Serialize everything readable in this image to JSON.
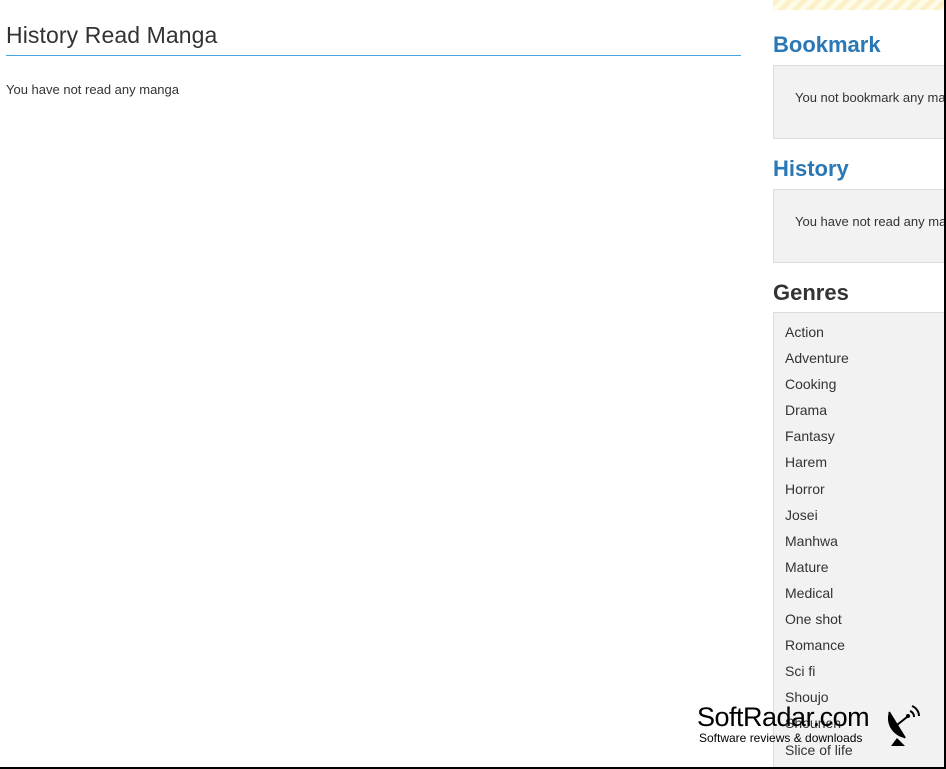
{
  "main": {
    "title": "History Read Manga",
    "empty_message": "You have not read any manga"
  },
  "sidebar": {
    "bookmark": {
      "title": "Bookmark",
      "message": "You not bookmark any ma"
    },
    "history": {
      "title": "History",
      "message": "You have not read any mar"
    },
    "genres": {
      "title": "Genres",
      "items": [
        "Action",
        "Adventure",
        "Cooking",
        "Drama",
        "Fantasy",
        "Harem",
        "Horror",
        "Josei",
        "Manhwa",
        "Mature",
        "Medical",
        "One shot",
        "Romance",
        "Sci fi",
        "Shoujo",
        "Shounen",
        "Slice of life"
      ]
    }
  },
  "watermark": {
    "name": "SoftRadar.com",
    "tagline": "Software reviews & downloads",
    "icon": "satellite-dish-icon"
  },
  "colors": {
    "accent": "#2a78b5",
    "divider": "#4aa3df",
    "box_bg": "#f2f2f2"
  }
}
